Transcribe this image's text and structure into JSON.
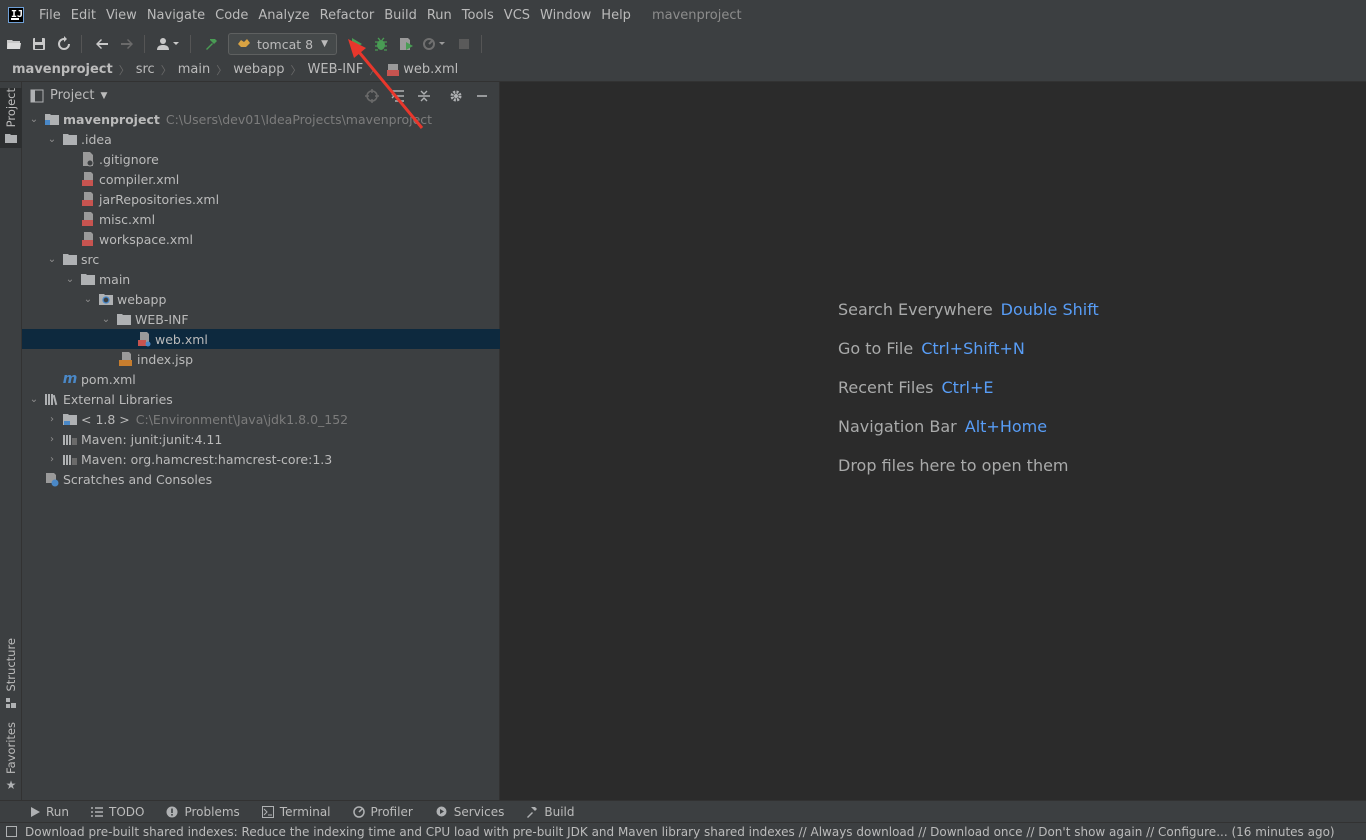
{
  "menubar": {
    "items": [
      "File",
      "Edit",
      "View",
      "Navigate",
      "Code",
      "Analyze",
      "Refactor",
      "Build",
      "Run",
      "Tools",
      "VCS",
      "Window",
      "Help"
    ],
    "window_title": "mavenproject"
  },
  "toolbar": {
    "run_config": "tomcat 8",
    "icons": [
      "open-folder-icon",
      "save-icon",
      "sync-icon",
      "back-icon",
      "forward-icon",
      "user-icon",
      "build-hammer-icon",
      "run-icon",
      "debug-icon",
      "coverage-icon",
      "profile-icon",
      "stop-icon"
    ]
  },
  "breadcrumb": {
    "items": [
      "mavenproject",
      "src",
      "main",
      "webapp",
      "WEB-INF",
      "web.xml"
    ]
  },
  "left_strip": {
    "project": "Project",
    "structure": "Structure",
    "favorites": "Favorites"
  },
  "project_panel": {
    "title": "Project",
    "tree": [
      {
        "label": "mavenproject",
        "hint": "C:\\Users\\dev01\\IdeaProjects\\mavenproject",
        "icon": "module-folder-icon",
        "expanded": true
      },
      {
        "label": ".idea",
        "icon": "folder-icon",
        "expanded": true
      },
      {
        "label": ".gitignore",
        "icon": "gitignore-file-icon"
      },
      {
        "label": "compiler.xml",
        "icon": "xml-file-icon"
      },
      {
        "label": "jarRepositories.xml",
        "icon": "xml-file-icon"
      },
      {
        "label": "misc.xml",
        "icon": "xml-file-icon"
      },
      {
        "label": "workspace.xml",
        "icon": "xml-file-icon"
      },
      {
        "label": "src",
        "icon": "folder-icon",
        "expanded": true
      },
      {
        "label": "main",
        "icon": "folder-icon",
        "expanded": true
      },
      {
        "label": "webapp",
        "icon": "web-folder-icon",
        "expanded": true
      },
      {
        "label": "WEB-INF",
        "icon": "folder-icon",
        "expanded": true
      },
      {
        "label": "web.xml",
        "icon": "web-xml-file-icon",
        "selected": true
      },
      {
        "label": "index.jsp",
        "icon": "jsp-file-icon"
      },
      {
        "label": "pom.xml",
        "icon": "maven-file-icon"
      },
      {
        "label": "External Libraries",
        "icon": "libraries-icon",
        "expanded": true
      },
      {
        "label": "< 1.8 >",
        "hint": "C:\\Environment\\Java\\jdk1.8.0_152",
        "icon": "jdk-icon",
        "expanded": false
      },
      {
        "label": "Maven: junit:junit:4.11",
        "icon": "library-icon",
        "expanded": false
      },
      {
        "label": "Maven: org.hamcrest:hamcrest-core:1.3",
        "icon": "library-icon",
        "expanded": false
      },
      {
        "label": "Scratches and Consoles",
        "icon": "scratches-icon"
      }
    ]
  },
  "editor": {
    "tips": [
      {
        "label": "Search Everywhere",
        "key": "Double Shift"
      },
      {
        "label": "Go to File",
        "key": "Ctrl+Shift+N"
      },
      {
        "label": "Recent Files",
        "key": "Ctrl+E"
      },
      {
        "label": "Navigation Bar",
        "key": "Alt+Home"
      },
      {
        "label": "Drop files here to open them",
        "key": ""
      }
    ]
  },
  "bottom_bar": {
    "tabs": [
      "Run",
      "TODO",
      "Problems",
      "Terminal",
      "Profiler",
      "Services",
      "Build"
    ]
  },
  "status_bar": {
    "message": "Download pre-built shared indexes: Reduce the indexing time and CPU load with pre-built JDK and Maven library shared indexes // Always download // Download once // Don't show again // Configure... (16 minutes ago)"
  },
  "colors": {
    "accent_key": "#589df6",
    "selection": "#0d293e",
    "run_green": "#499c54",
    "annotation_red": "#e8372c"
  }
}
